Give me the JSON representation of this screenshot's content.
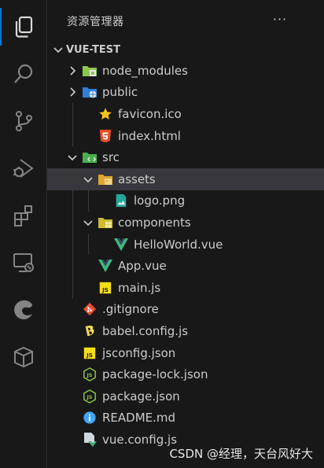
{
  "explorer": {
    "title": "资源管理器",
    "more_label": "···",
    "root": "VUE-TEST"
  },
  "activity_bar": [
    {
      "name": "explorer-icon",
      "active": true
    },
    {
      "name": "search-icon",
      "active": false
    },
    {
      "name": "source-control-icon",
      "active": false
    },
    {
      "name": "run-debug-icon",
      "active": false
    },
    {
      "name": "extensions-icon",
      "active": false
    },
    {
      "name": "remote-explorer-icon",
      "active": false
    },
    {
      "name": "edge-icon",
      "active": false
    },
    {
      "name": "package-icon",
      "active": false
    }
  ],
  "tree": [
    {
      "label": "node_modules",
      "depth": 0,
      "type": "folder",
      "expanded": false,
      "icon": "folder-node-icon"
    },
    {
      "label": "public",
      "depth": 0,
      "type": "folder",
      "expanded": false,
      "icon": "folder-public-icon"
    },
    {
      "label": "favicon.ico",
      "depth": 1,
      "type": "file",
      "icon": "star-icon"
    },
    {
      "label": "index.html",
      "depth": 1,
      "type": "file",
      "icon": "html-icon"
    },
    {
      "label": "src",
      "depth": 0,
      "type": "folder",
      "expanded": true,
      "icon": "folder-src-icon"
    },
    {
      "label": "assets",
      "depth": 1,
      "type": "folder",
      "expanded": true,
      "icon": "folder-assets-icon",
      "selected": true
    },
    {
      "label": "logo.png",
      "depth": 2,
      "type": "file",
      "icon": "image-icon"
    },
    {
      "label": "components",
      "depth": 1,
      "type": "folder",
      "expanded": true,
      "icon": "folder-components-icon"
    },
    {
      "label": "HelloWorld.vue",
      "depth": 2,
      "type": "file",
      "icon": "vue-icon"
    },
    {
      "label": "App.vue",
      "depth": 1,
      "type": "file",
      "icon": "vue-icon"
    },
    {
      "label": "main.js",
      "depth": 1,
      "type": "file",
      "icon": "js-icon"
    },
    {
      "label": ".gitignore",
      "depth": 0,
      "type": "file",
      "icon": "git-icon"
    },
    {
      "label": "babel.config.js",
      "depth": 0,
      "type": "file",
      "icon": "babel-icon"
    },
    {
      "label": "jsconfig.json",
      "depth": 0,
      "type": "file",
      "icon": "js-icon"
    },
    {
      "label": "package-lock.json",
      "depth": 0,
      "type": "file",
      "icon": "nodejs-icon"
    },
    {
      "label": "package.json",
      "depth": 0,
      "type": "file",
      "icon": "nodejs-icon"
    },
    {
      "label": "README.md",
      "depth": 0,
      "type": "file",
      "icon": "info-icon"
    },
    {
      "label": "vue.config.js",
      "depth": 0,
      "type": "file",
      "icon": "vue-config-icon"
    }
  ],
  "watermark": "CSDN @经理，天台风好大",
  "colors": {
    "background": "#181818",
    "selected_row": "#37373d",
    "accent": "#0078d4",
    "vue": "#41b883",
    "js": "#f5de19",
    "html": "#e44d26",
    "node": "#8cc84b"
  }
}
